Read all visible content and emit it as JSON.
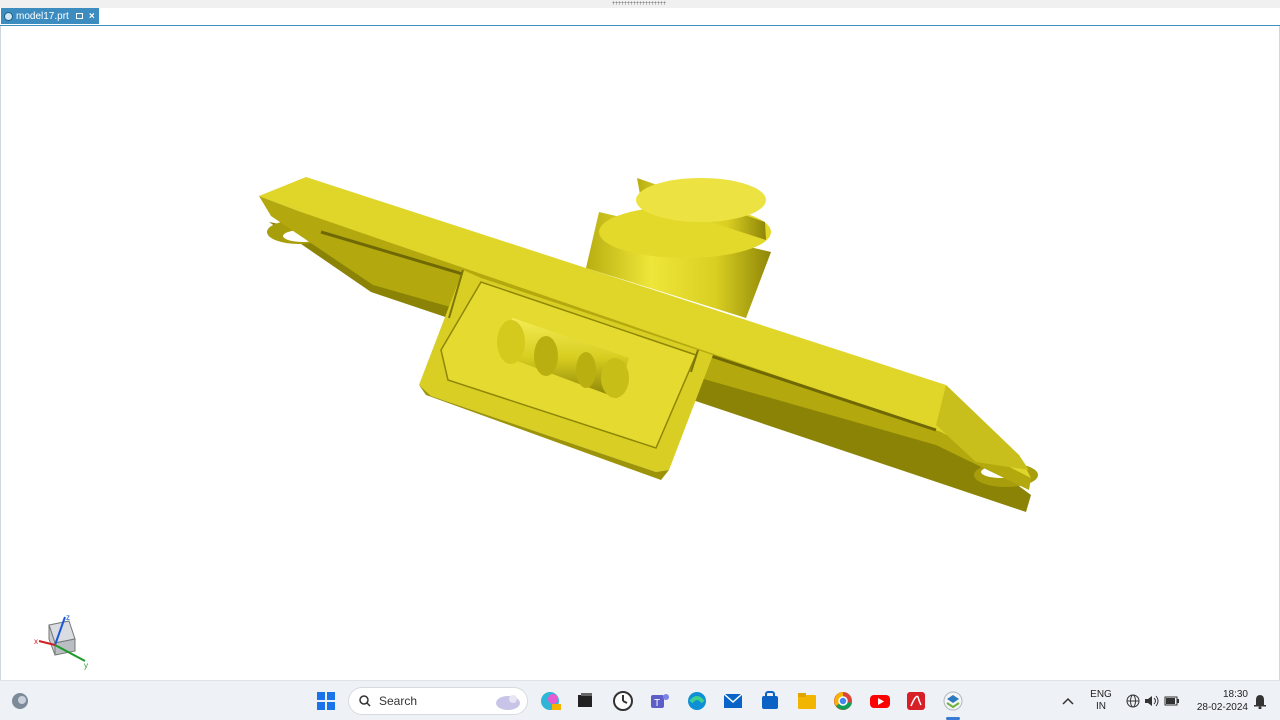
{
  "window": {
    "tab_title": "model17.prt",
    "close_glyph": "×"
  },
  "viewport": {
    "model_color": "#e3d92b",
    "triad_axes": [
      "z",
      "x",
      "y"
    ]
  },
  "taskbar": {
    "search_label": "Search",
    "apps": [
      "file-explorer-app",
      "start-button",
      "edge-app",
      "outlook-app",
      "teams-app",
      "chrome-app",
      "youtube-app",
      "acrobat-app",
      "cad-app"
    ],
    "language_top": "ENG",
    "language_bottom": "IN",
    "time": "18:30",
    "date": "28-02-2024"
  }
}
